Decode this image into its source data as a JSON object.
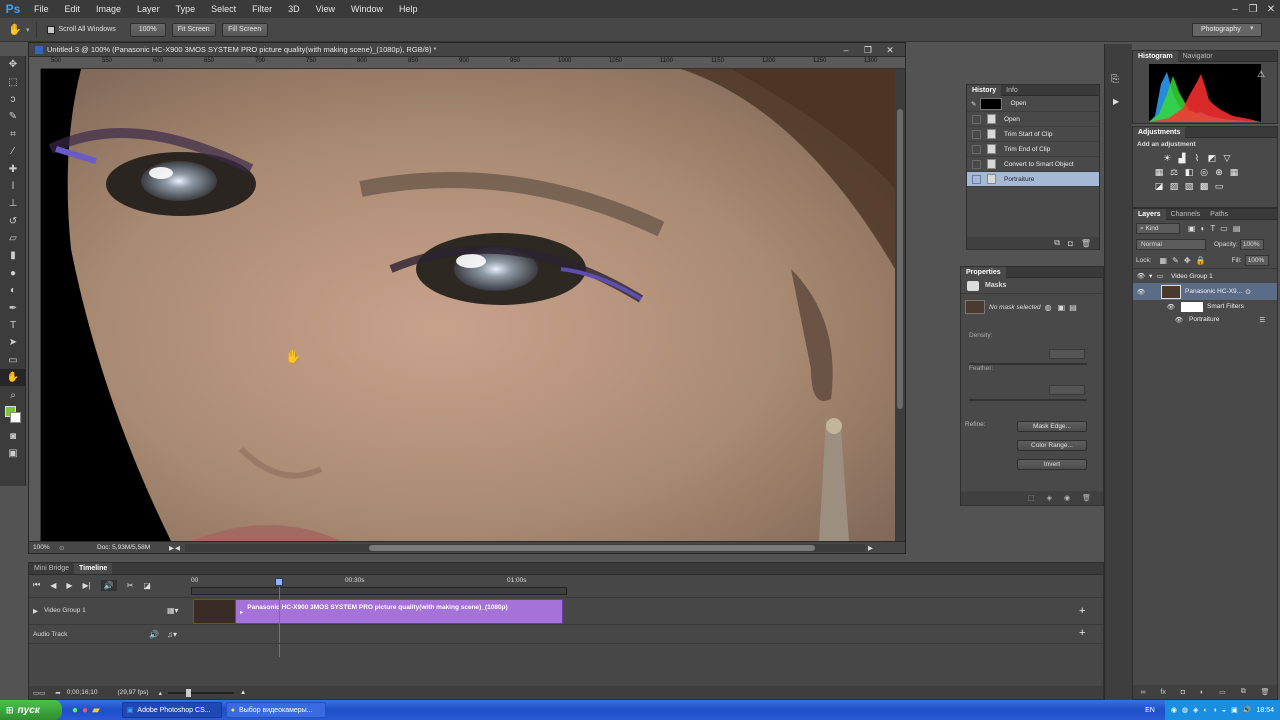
{
  "app": {
    "logo": "Ps"
  },
  "menu": [
    "File",
    "Edit",
    "Image",
    "Layer",
    "Type",
    "Select",
    "Filter",
    "3D",
    "View",
    "Window",
    "Help"
  ],
  "options": {
    "scroll_all_windows": "Scroll All Windows",
    "zoom_100": "100%",
    "fit_screen": "Fit Screen",
    "fill_screen": "Fill Screen",
    "workspace": "Photography"
  },
  "document": {
    "title": "Untitled-3 @ 100% (Panasonic HC-X900 3MOS SYSTEM PRO picture quality(with making scene)_(1080p), RGB/8) *",
    "ruler_ticks": [
      "500",
      "550",
      "600",
      "650",
      "700",
      "750",
      "800",
      "850",
      "900",
      "950",
      "1000",
      "1050",
      "1100",
      "1150",
      "1200",
      "1250",
      "1300"
    ],
    "zoom": "100%",
    "doc_size": "Doc: 5,93M/5,58M"
  },
  "history": {
    "tabs": [
      "History",
      "Info"
    ],
    "snapshot": "Open",
    "items": [
      "Open",
      "Trim Start of Clip",
      "Trim End of Clip",
      "Convert to Smart Object",
      "Portraiture"
    ],
    "selected_index": 4
  },
  "properties": {
    "title": "Properties",
    "section": "Masks",
    "mask_status": "No mask selected",
    "density_label": "Density:",
    "feather_label": "Feather:",
    "refine_label": "Refine:",
    "mask_edge": "Mask Edge...",
    "color_range": "Color Range...",
    "invert": "Invert"
  },
  "histogram": {
    "tabs": [
      "Histogram",
      "Navigator"
    ]
  },
  "adjustments": {
    "title": "Adjustments",
    "add_label": "Add an adjustment"
  },
  "layers": {
    "tabs": [
      "Layers",
      "Channels",
      "Paths"
    ],
    "kind": "Kind",
    "blend_mode": "Normal",
    "opacity_label": "Opacity:",
    "opacity": "100%",
    "lock_label": "Lock:",
    "fill_label": "Fill:",
    "fill": "100%",
    "group": "Video Group 1",
    "layer": "Panasonic HC-X9...",
    "smart_filters": "Smart Filters",
    "filter": "Portraiture"
  },
  "timeline": {
    "tabs": [
      "Mini Bridge",
      "Timeline"
    ],
    "ticks": [
      "00",
      "00:30s",
      "01:00s"
    ],
    "video_track": "Video Group 1",
    "clip": "Panasonic HC-X900 3MOS SYSTEM PRO picture quality(with making scene)_(1080p)",
    "audio_track": "Audio Track",
    "timecode": "0;00;16;10",
    "fps": "(29,97 fps)"
  },
  "taskbar": {
    "start": "пуск",
    "tasks": [
      "Adobe Photoshop CS...",
      "Выбор видеокамеры..."
    ],
    "lang": "EN",
    "time": "18:54"
  },
  "colors": {
    "clip": "#a572d8",
    "selection": "#a5b9d4",
    "taskbar": "#2457d0",
    "start": "#3aa83a"
  }
}
